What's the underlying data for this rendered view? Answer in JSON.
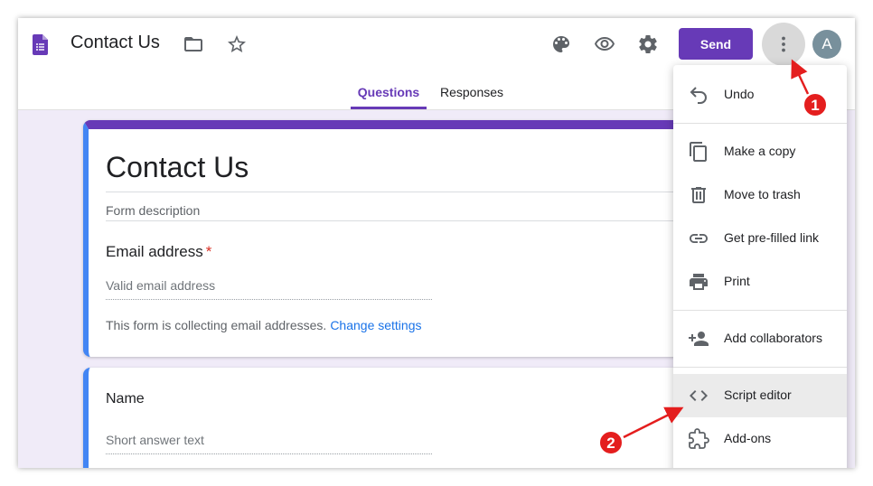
{
  "header": {
    "title": "Contact Us",
    "send_label": "Send",
    "avatar_initial": "A"
  },
  "tabs": [
    {
      "label": "Questions",
      "active": true
    },
    {
      "label": "Responses",
      "active": false
    }
  ],
  "form": {
    "title": "Contact Us",
    "description_placeholder": "Form description",
    "questions": [
      {
        "label": "Email address",
        "required_mark": "*",
        "placeholder": "Valid email address"
      },
      {
        "label": "Name",
        "placeholder": "Short answer text"
      }
    ],
    "collecting_text": "This form is collecting email addresses.",
    "change_settings": "Change settings"
  },
  "menu": {
    "items": [
      {
        "label": "Undo",
        "icon": "undo-icon"
      },
      {
        "label": "Make a copy",
        "icon": "copy-icon"
      },
      {
        "label": "Move to trash",
        "icon": "trash-icon"
      },
      {
        "label": "Get pre-filled link",
        "icon": "link-icon"
      },
      {
        "label": "Print",
        "icon": "print-icon"
      },
      {
        "label": "Add collaborators",
        "icon": "add-people-icon"
      },
      {
        "label": "Script editor",
        "icon": "code-icon",
        "highlighted": true
      },
      {
        "label": "Add-ons",
        "icon": "puzzle-icon"
      }
    ]
  },
  "annotations": [
    {
      "number": "1"
    },
    {
      "number": "2"
    }
  ],
  "colors": {
    "brand": "#673ab7",
    "accent_blue": "#4285f4",
    "link": "#1a73e8",
    "annotation_red": "#e41e1e",
    "background": "#f0ebf8"
  }
}
